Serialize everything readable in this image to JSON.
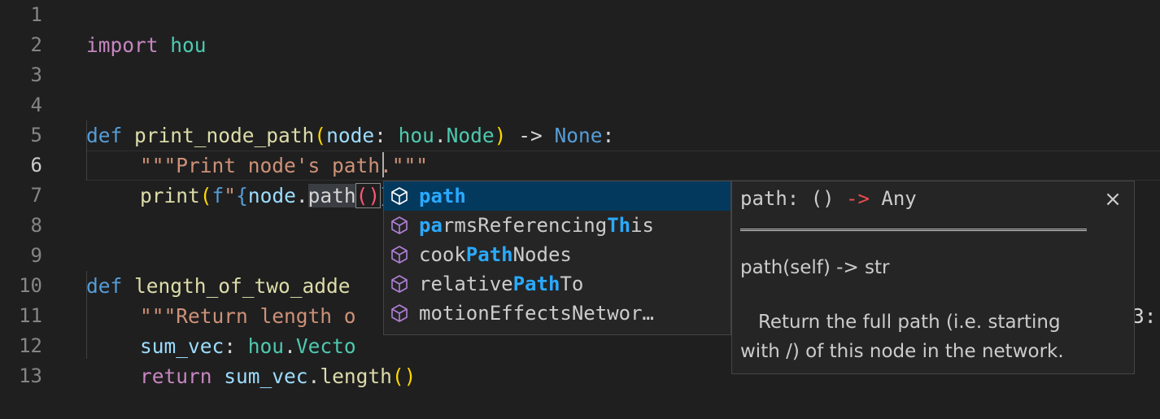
{
  "editor": {
    "line_numbers": [
      "1",
      "2",
      "3",
      "4",
      "5",
      "6",
      "7",
      "8",
      "9",
      "10",
      "11",
      "12",
      "13"
    ],
    "active_line": "6",
    "lines": {
      "l1": {
        "kw": "import",
        "mod": "hou"
      },
      "l4": {
        "def": "def",
        "name": "print_node_path",
        "open": "(",
        "param": "node",
        "colon": ":",
        "mod": "hou",
        "dot": ".",
        "cls": "Node",
        "close": ")",
        "arrow": "->",
        "ret": "None",
        "end": ":"
      },
      "l5": {
        "doc": "\"\"\"Print node's path.\"\"\""
      },
      "l6": {
        "fn": "print",
        "open": "(",
        "fprefix": "f",
        "q1": "\"",
        "brace_open": "{",
        "obj": "node",
        "dot": ".",
        "attr": "path",
        "call": "()",
        "brace_close": "}",
        "q2": "\"",
        "close": ")"
      },
      "l9": {
        "def": "def",
        "name_visible": "length_of_two_adde",
        "tail": "3:"
      },
      "l10": {
        "doc_visible": "\"\"\"Return length o"
      },
      "l11": {
        "var": "sum_vec",
        "colon": ":",
        "mod": "hou",
        "dot": ".",
        "cls_visible": "Vecto"
      },
      "l12": {
        "kw": "return",
        "obj": "sum_vec",
        "dot": ".",
        "method": "length",
        "call": "()"
      }
    }
  },
  "suggest": {
    "items": [
      {
        "pre": "",
        "match1": "path",
        "mid": "",
        "match2": "",
        "post": "",
        "icon": "method-cube-icon"
      },
      {
        "pre": "",
        "match1": "pa",
        "mid": "rmsReferencing",
        "match2": "Th",
        "post": "is",
        "icon": "method-cube-icon"
      },
      {
        "pre": "cook",
        "match1": "Path",
        "mid": "Nodes",
        "match2": "",
        "post": "",
        "icon": "method-cube-icon"
      },
      {
        "pre": "relative",
        "match1": "Path",
        "mid": "To",
        "match2": "",
        "post": "",
        "icon": "method-cube-icon"
      },
      {
        "pre": "motionEffectsNetwor…",
        "match1": "",
        "mid": "",
        "match2": "",
        "post": "",
        "icon": "method-cube-icon"
      }
    ],
    "selected_index": 0
  },
  "details": {
    "signature_name": "path: ()",
    "signature_arrow": "->",
    "signature_type": "Any",
    "close_glyph": "×",
    "doc_signature": "path(self) -> str",
    "doc_text": "   Return the full path (i.e. starting\nwith /) of this node in the network."
  },
  "colors": {
    "background": "#1f1f1f",
    "keyword": "#c586c0",
    "function": "#dcdcaa",
    "class": "#4ec9b0",
    "string": "#ce9178",
    "match_highlight": "#2aaaff",
    "selected_row": "#04395e"
  }
}
